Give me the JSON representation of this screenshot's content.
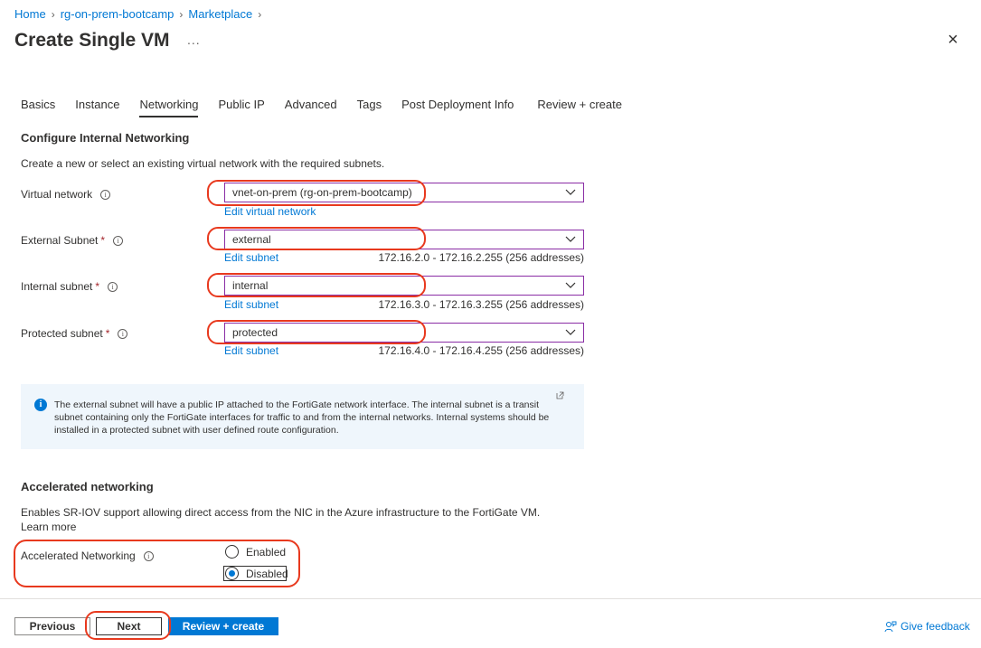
{
  "breadcrumb": {
    "items": [
      "Home",
      "rg-on-prem-bootcamp",
      "Marketplace"
    ]
  },
  "header": {
    "title": "Create Single VM",
    "more": "...",
    "close": "×"
  },
  "tabs": [
    {
      "label": "Basics"
    },
    {
      "label": "Instance"
    },
    {
      "label": "Networking",
      "active": true
    },
    {
      "label": "Public IP"
    },
    {
      "label": "Advanced"
    },
    {
      "label": "Tags"
    },
    {
      "label": "Post Deployment Info"
    },
    {
      "label": "Review + create"
    }
  ],
  "internal_networking": {
    "title": "Configure Internal Networking",
    "description": "Create a new or select an existing virtual network with the required subnets.",
    "virtual_network": {
      "label": "Virtual network",
      "value": "vnet-on-prem (rg-on-prem-bootcamp)",
      "edit_link": "Edit virtual network"
    },
    "external_subnet": {
      "label": "External Subnet",
      "required": "*",
      "value": "external",
      "edit_link": "Edit subnet",
      "range": "172.16.2.0 - 172.16.2.255 (256 addresses)"
    },
    "internal_subnet": {
      "label": "Internal subnet",
      "required": "*",
      "value": "internal",
      "edit_link": "Edit subnet",
      "range": "172.16.3.0 - 172.16.3.255 (256 addresses)"
    },
    "protected_subnet": {
      "label": "Protected subnet",
      "required": "*",
      "value": "protected",
      "edit_link": "Edit subnet",
      "range": "172.16.4.0 - 172.16.4.255 (256 addresses)"
    },
    "info_text": "The external subnet will have a public IP attached to the FortiGate network interface. The internal subnet is a transit subnet containing only the FortiGate interfaces for traffic to and from the internal networks. Internal systems should be installed in a protected subnet with user defined route configuration."
  },
  "accelerated": {
    "title": "Accelerated networking",
    "description": "Enables SR-IOV support allowing direct access from the NIC in the Azure infrastructure to the FortiGate VM.",
    "learn_more": "Learn more",
    "label": "Accelerated Networking",
    "options": [
      {
        "label": "Enabled",
        "checked": false
      },
      {
        "label": "Disabled",
        "checked": true
      }
    ]
  },
  "footer": {
    "previous": "Previous",
    "next": "Next",
    "review_create": "Review + create",
    "feedback": "Give feedback"
  },
  "colors": {
    "accent": "#0078d4",
    "highlight": "#e8391e",
    "select_border": "#8a2da5",
    "required": "#a4262c"
  },
  "icons": {
    "info": "info-circle-icon",
    "chevron": "chevron-down-icon",
    "close": "close-icon",
    "external": "external-link-icon",
    "feedback": "feedback-person-icon"
  }
}
